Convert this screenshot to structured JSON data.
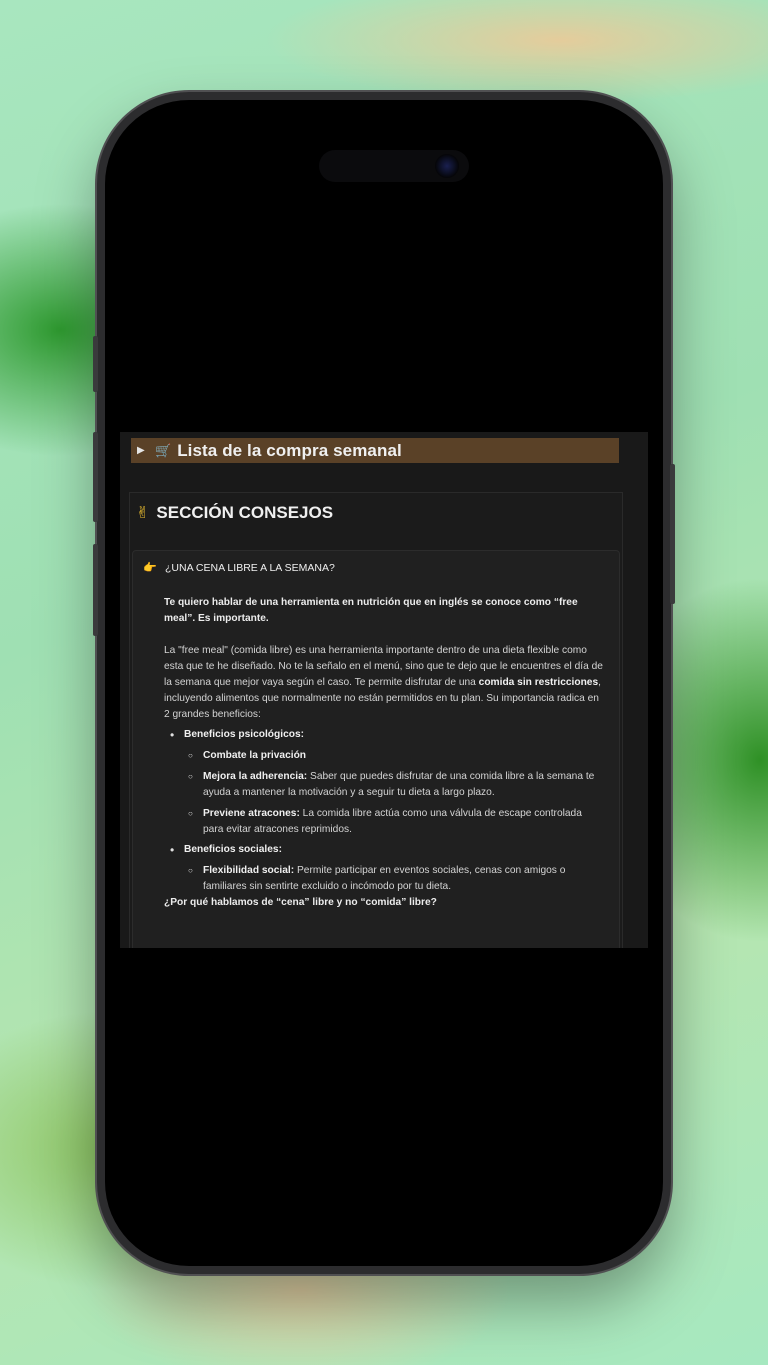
{
  "toggle": {
    "arrow_icon": "triangle-right-icon",
    "icon": "shopping-cart-icon",
    "title": "Lista de la compra semanal",
    "background": "#5a4127"
  },
  "section": {
    "icon": "victory-hand-icon",
    "title": "SECCIÓN CONSEJOS"
  },
  "callout": {
    "icon": "pointing-hand-icon",
    "title": "¿UNA CENA LIBRE A LA SEMANA?",
    "intro": "Te quiero hablar de una herramienta en nutrición que en inglés se conoce como “free meal”. Es importante.",
    "para_part1": "La \"free meal\" (comida libre) es una herramienta importante dentro de una dieta flexible como esta que te he diseñado. No te la señalo en el menú, sino que te dejo que le encuentres el día de la semana que mejor vaya según el caso. Te permite disfrutar de una ",
    "para_bold": "comida sin restricciones",
    "para_part2": ", incluyendo alimentos que normalmente no están permitidos en tu plan. Su importancia radica en 2 grandes beneficios:",
    "benefits": [
      {
        "title": "Beneficios psicológicos:",
        "items": [
          {
            "bold": "Combate la privación",
            "text": ""
          },
          {
            "bold": "Mejora la adherencia:",
            "text": " Saber que puedes disfrutar de una comida libre a la semana te ayuda a mantener la motivación y a seguir tu dieta a largo plazo."
          },
          {
            "bold": "Previene atracones:",
            "text": " La comida libre actúa como una válvula de escape controlada para evitar atracones reprimidos."
          }
        ]
      },
      {
        "title": "Beneficios sociales:",
        "items": [
          {
            "bold": "Flexibilidad social:",
            "text": " Permite participar en eventos sociales, cenas con amigos o familiares sin sentirte excluido o incómodo por tu dieta."
          }
        ]
      }
    ],
    "question": "¿Por qué hablamos de “cena” libre y no “comida” libre?"
  }
}
